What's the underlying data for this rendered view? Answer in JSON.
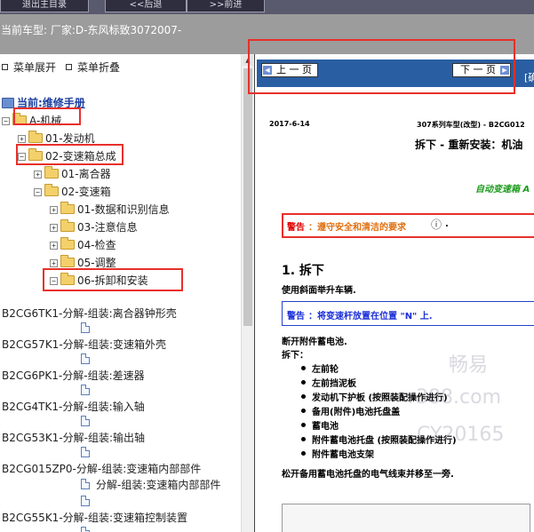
{
  "toolbar": {
    "buttons": [
      {
        "label": "退出主目录"
      },
      {
        "label": "<<后退"
      },
      {
        "label": ">>前进"
      }
    ]
  },
  "vehicle": {
    "label": "当前车型:   厂家:D-东风标致3072007-"
  },
  "tree": {
    "expand_all": "菜单展开",
    "collapse_all": "菜单折叠",
    "current_manual": "当前:维修手册",
    "nodes": [
      {
        "label": "A-机械"
      },
      {
        "label": "01-发动机"
      },
      {
        "label": "02-变速箱总成"
      },
      {
        "label": "01-离合器"
      },
      {
        "label": "02-变速箱"
      },
      {
        "label": "01-数据和识别信息"
      },
      {
        "label": "03-注意信息"
      },
      {
        "label": "04-检查"
      },
      {
        "label": "05-调整"
      },
      {
        "label": "06-拆卸和安装"
      }
    ],
    "docs": [
      {
        "label": "B2CG6TK1-分解-组装:离合器钟形壳"
      },
      {
        "label": "B2CG57K1-分解-组装:变速箱外壳"
      },
      {
        "label": "B2CG6PK1-分解-组装:差速器"
      },
      {
        "label": "B2CG4TK1-分解-组装:输入轴"
      },
      {
        "label": "B2CG53K1-分解-组装:输出轴"
      },
      {
        "label": "B2CG015ZP0-分解-组装:变速箱内部部件"
      },
      {
        "label": "分解-组装:变速箱内部部件"
      },
      {
        "label": "B2CG55K1-分解-组装:变速箱控制装置"
      }
    ]
  },
  "doc": {
    "prev_label": "上 一 页",
    "next_label": "下 一 页",
    "side_label": "[确",
    "date": "2017-6-14",
    "model_ref": "307系列车型(改型) - B2CG012",
    "heading": "拆下 - 重新安装：机油",
    "green_label": "自动变速箱 A",
    "danger_label": "警告",
    "danger_text": "：遵守安全和清洁的要求",
    "danger_tail": ".",
    "section": "1. 拆下",
    "step1": "使用斜面举升车辆.",
    "note_label": "警告",
    "note_text": "：将变速杆放置在位置 \"N\" 上.",
    "step2": "断开附件蓄电池.",
    "step3": "拆下：",
    "bullets": [
      "左前轮",
      "左前挡泥板",
      "发动机下护板 (按照装配操作进行)",
      "备用(附件)电池托盘盖",
      "蓄电池",
      "附件蓄电池托盘 (按照装配操作进行)",
      "附件蓄电池支架"
    ],
    "step4": "松开备用蓄电池托盘的电气线束并移至一旁.",
    "watermark_1": "畅易",
    "watermark_2": "r388.com",
    "watermark_3": "CY20165"
  },
  "colors": {
    "toolbar_bg": "#5a5a6e",
    "vehicle_bar_bg": "#9c9c9c",
    "nav_bar_bg": "#2a5ea2",
    "highlight_red": "#e8302a",
    "warning_red": "#e00000",
    "warning_orange": "#e07010",
    "note_blue": "#1a2ed8",
    "green_label": "#1a9a1a"
  }
}
